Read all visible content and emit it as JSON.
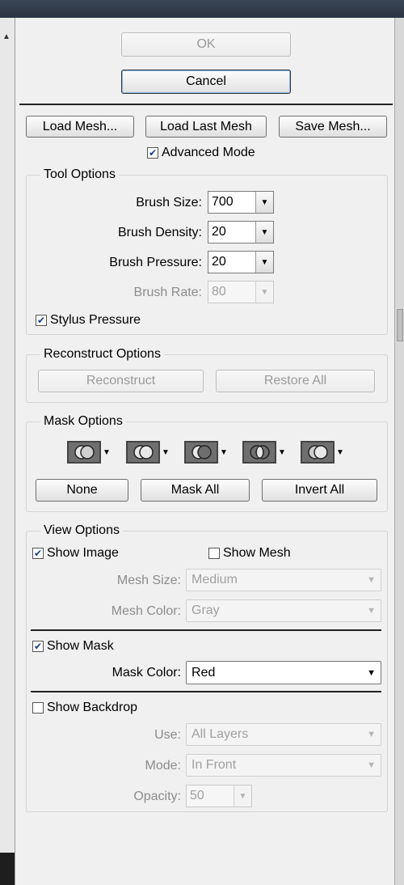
{
  "dialog": {
    "ok_label": "OK",
    "cancel_label": "Cancel",
    "load_mesh_label": "Load Mesh...",
    "load_last_mesh_label": "Load Last Mesh",
    "save_mesh_label": "Save Mesh...",
    "advanced_mode_label": "Advanced Mode",
    "advanced_mode_checked": true
  },
  "tool_options": {
    "title": "Tool Options",
    "brush_size_label": "Brush Size:",
    "brush_size_value": "700",
    "brush_density_label": "Brush Density:",
    "brush_density_value": "20",
    "brush_pressure_label": "Brush Pressure:",
    "brush_pressure_value": "20",
    "brush_rate_label": "Brush Rate:",
    "brush_rate_value": "80",
    "stylus_pressure_label": "Stylus Pressure",
    "stylus_pressure_checked": true
  },
  "reconstruct_options": {
    "title": "Reconstruct Options",
    "reconstruct_label": "Reconstruct",
    "restore_all_label": "Restore All"
  },
  "mask_options": {
    "title": "Mask Options",
    "icons": [
      "mask-replace-icon",
      "mask-add-icon",
      "mask-subtract-icon",
      "mask-intersect-icon",
      "mask-invert-icon"
    ],
    "none_label": "None",
    "mask_all_label": "Mask All",
    "invert_all_label": "Invert All"
  },
  "view_options": {
    "title": "View Options",
    "show_image_label": "Show Image",
    "show_image_checked": true,
    "show_mesh_label": "Show Mesh",
    "show_mesh_checked": false,
    "mesh_size_label": "Mesh Size:",
    "mesh_size_value": "Medium",
    "mesh_color_label": "Mesh Color:",
    "mesh_color_value": "Gray",
    "show_mask_label": "Show Mask",
    "show_mask_checked": true,
    "mask_color_label": "Mask Color:",
    "mask_color_value": "Red",
    "show_backdrop_label": "Show Backdrop",
    "show_backdrop_checked": false,
    "use_label": "Use:",
    "use_value": "All Layers",
    "mode_label": "Mode:",
    "mode_value": "In Front",
    "opacity_label": "Opacity:",
    "opacity_value": "50"
  },
  "colors": {
    "panel_bg": "#f0f0f0",
    "checkmark": "#1a3c8c",
    "disabled_text": "#a0a0a0"
  }
}
